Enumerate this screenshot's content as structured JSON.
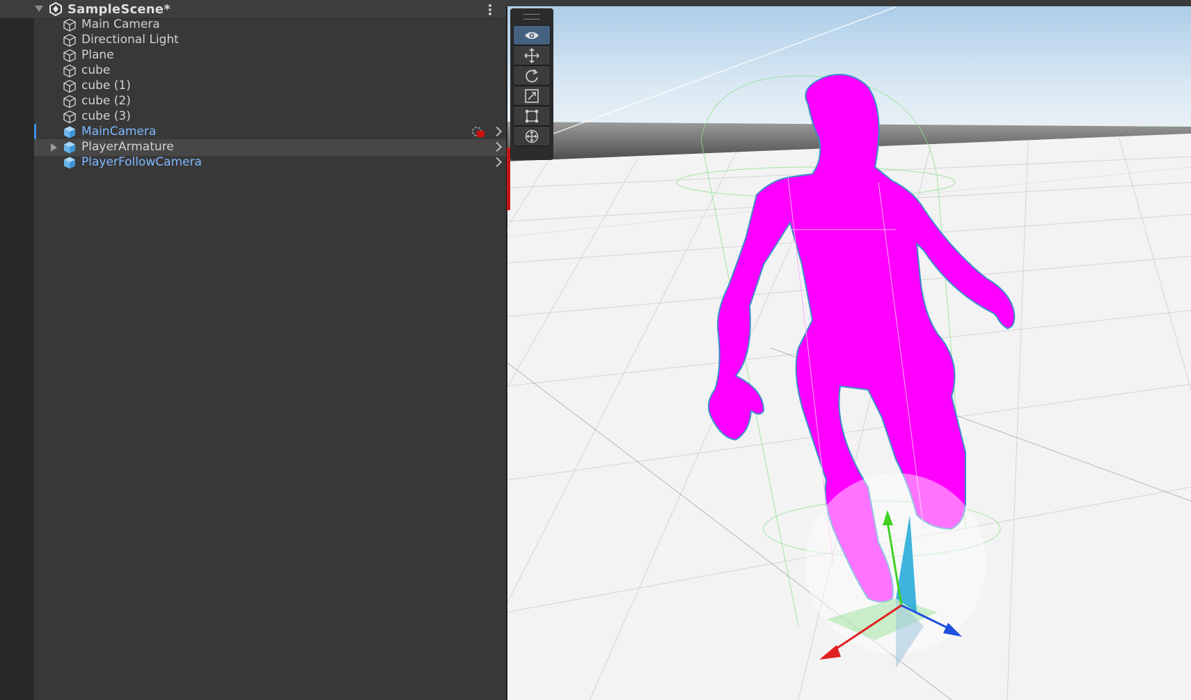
{
  "hierarchy": {
    "scene_title": "SampleScene*",
    "items": [
      {
        "label": "Main Camera",
        "icon": "gameobject-cube-icon"
      },
      {
        "label": "Directional Light",
        "icon": "gameobject-cube-icon"
      },
      {
        "label": "Plane",
        "icon": "gameobject-cube-icon"
      },
      {
        "label": "cube",
        "icon": "gameobject-cube-icon"
      },
      {
        "label": "cube (1)",
        "icon": "gameobject-cube-icon"
      },
      {
        "label": "cube (2)",
        "icon": "gameobject-cube-icon"
      },
      {
        "label": "cube (3)",
        "icon": "gameobject-cube-icon"
      },
      {
        "label": "MainCamera",
        "icon": "prefab-cube-icon"
      },
      {
        "label": "PlayerArmature",
        "icon": "prefab-cube-icon"
      },
      {
        "label": "PlayerFollowCamera",
        "icon": "prefab-cube-icon"
      }
    ]
  },
  "scene_view": {
    "tools": [
      "view-tool-icon",
      "move-tool-icon",
      "rotate-tool-icon",
      "scale-tool-icon",
      "rect-tool-icon",
      "transform-tool-icon"
    ],
    "active_tool": "view-tool-icon",
    "character_color": "#ff00ff",
    "colors": {
      "accent": "#7db7ff",
      "x_axis": "#e02020",
      "y_axis": "#40d020",
      "z_axis": "#2050e0"
    }
  }
}
